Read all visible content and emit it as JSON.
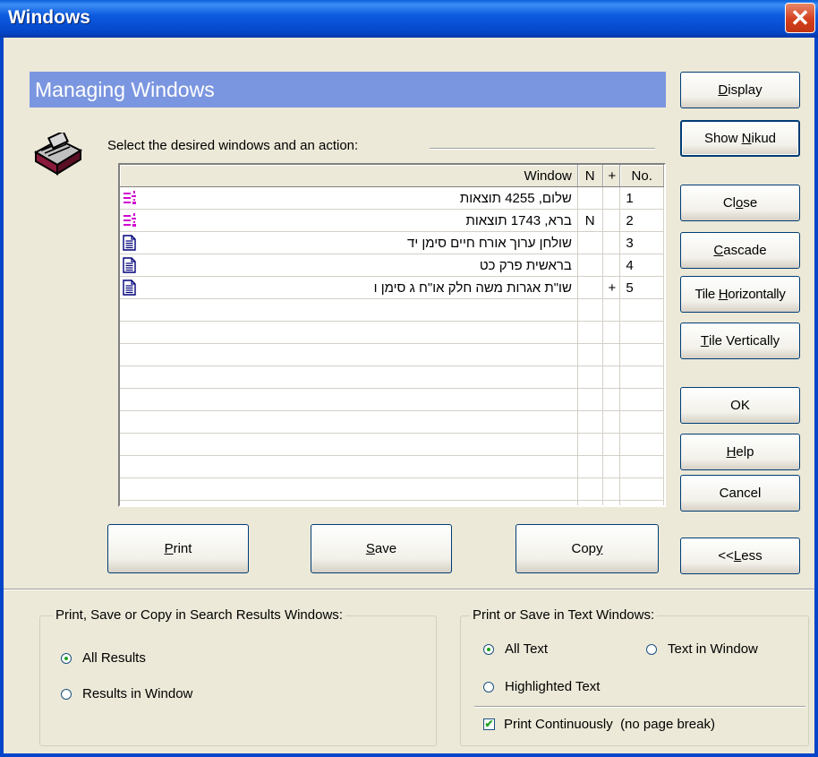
{
  "window": {
    "title": "Windows",
    "close_label": "✕"
  },
  "heading": "Managing Windows",
  "instruction": "Select the desired windows and  an action:",
  "table": {
    "headers": {
      "window": "Window",
      "n": "N",
      "plus": "+",
      "no": "No."
    },
    "rows": [
      {
        "icon": "search-results-icon",
        "window": "שלום, 4255 תוצאות",
        "n": "",
        "plus": "",
        "no": "1"
      },
      {
        "icon": "search-results-icon",
        "window": "ברא, 1743 תוצאות",
        "n": "N",
        "plus": "",
        "no": "2"
      },
      {
        "icon": "document-icon",
        "window": "שולחן ערוך אורח חיים סימן יד",
        "n": "",
        "plus": "",
        "no": "3"
      },
      {
        "icon": "document-icon",
        "window": "בראשית פרק כט",
        "n": "",
        "plus": "",
        "no": "4"
      },
      {
        "icon": "document-icon",
        "window": "שו\"ת אגרות משה חלק או\"ח ג סימן ו",
        "n": "",
        "plus": "+",
        "no": "5"
      }
    ]
  },
  "buttons": {
    "display": {
      "pre": "",
      "u": "D",
      "post": "isplay"
    },
    "show_nikud": {
      "pre": "Show ",
      "u": "N",
      "post": "ikud"
    },
    "close": {
      "pre": "Cl",
      "u": "o",
      "post": "se"
    },
    "cascade": {
      "pre": "",
      "u": "C",
      "post": "ascade"
    },
    "tile_h": {
      "pre": "Tile ",
      "u": "H",
      "post": "orizontally"
    },
    "tile_v": {
      "pre": "",
      "u": "T",
      "post": "ile Vertically"
    },
    "ok": "OK",
    "help": {
      "pre": "",
      "u": "H",
      "post": "elp"
    },
    "cancel": "Cancel",
    "print": {
      "pre": "",
      "u": "P",
      "post": "rint"
    },
    "save": {
      "pre": "",
      "u": "S",
      "post": "ave"
    },
    "copy": {
      "pre": "Cop",
      "u": "y",
      "post": ""
    },
    "less": {
      "pre": "<<",
      "u": "L",
      "post": "ess"
    }
  },
  "search_group": {
    "legend": "Print, Save or Copy in Search Results Windows:",
    "all_results": "All Results",
    "results_in_window": "Results in Window",
    "selected": "all_results"
  },
  "text_group": {
    "legend": "Print or Save in Text Windows:",
    "all_text": "All Text",
    "text_in_window": "Text in Window",
    "highlighted_text": "Highlighted Text",
    "selected": "all_text",
    "print_continuously": "Print Continuously  (no page break)",
    "print_continuously_checked": true
  }
}
